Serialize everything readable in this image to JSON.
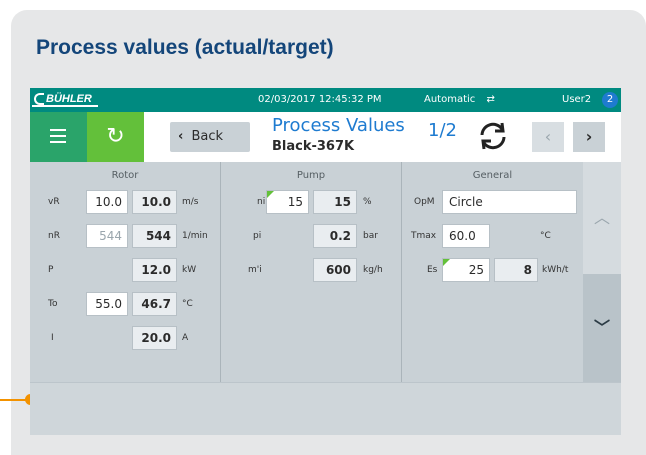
{
  "page": {
    "heading": "Process values (actual/target)"
  },
  "topbar": {
    "logo": "BÜHLER",
    "datetime": "02/03/2017 12:45:32 PM",
    "mode": "Automatic",
    "mode_icon": "⇄",
    "user": "User2",
    "user_badge": "2"
  },
  "navbar": {
    "menu_icon": "hamburger-icon",
    "refresh_icon": "↻",
    "back_chevron": "‹",
    "back_label": "Back",
    "title": "Process Values",
    "subtitle": "Black-367K",
    "page_indicator": "1/2",
    "prev": "‹",
    "next": "›"
  },
  "rotor": {
    "title": "Rotor",
    "rows": [
      {
        "label": "vR",
        "target": "10.0",
        "actual": "10.0",
        "unit": "m/s"
      },
      {
        "label": "nR",
        "target": "544",
        "actual": "544",
        "unit": "1/min"
      },
      {
        "label": "P",
        "actual": "12.0",
        "unit": "kW"
      },
      {
        "label": "To",
        "target": "55.0",
        "actual": "46.7",
        "unit": "°C"
      },
      {
        "label": "I",
        "actual": "20.0",
        "unit": "A"
      }
    ]
  },
  "pump": {
    "title": "Pump",
    "rows": [
      {
        "label": "ni",
        "target": "15",
        "actual": "15",
        "unit": "%"
      },
      {
        "label": "pi",
        "actual": "0.2",
        "unit": "bar"
      },
      {
        "label": "m'i",
        "actual": "600",
        "unit": "kg/h"
      }
    ]
  },
  "general": {
    "title": "General",
    "rows": [
      {
        "label": "OpM",
        "value": "Circle"
      },
      {
        "label": "Tmax",
        "target": "60.0",
        "unit": "°C"
      },
      {
        "label": "Es",
        "target": "25",
        "actual": "8",
        "unit": "kWh/t"
      }
    ]
  },
  "scroll": {
    "up": "︿",
    "down": "﹀"
  },
  "colors": {
    "brand": "#008a80",
    "accent": "#1e7bd0",
    "callout": "#f39200",
    "green": "#63c03a"
  }
}
